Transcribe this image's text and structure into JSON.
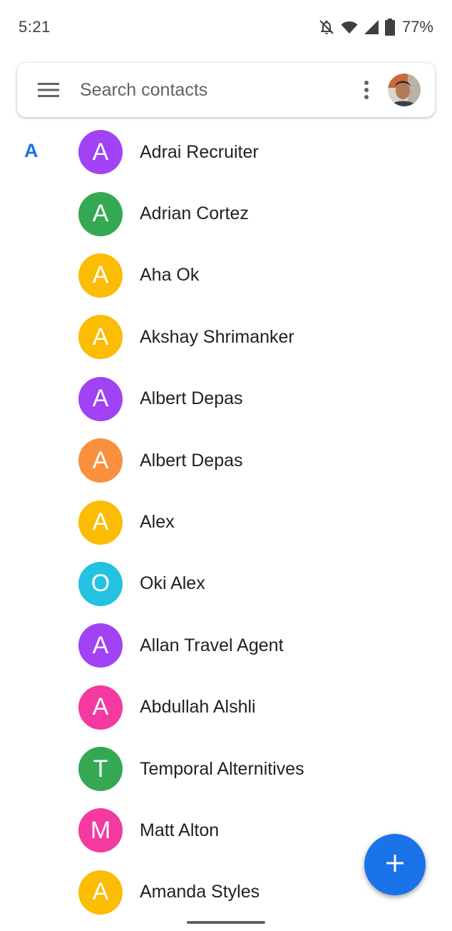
{
  "status_bar": {
    "time": "5:21",
    "battery_percent": "77%",
    "icons": [
      "notifications-off-icon",
      "wifi-icon",
      "cellular-signal-icon",
      "battery-icon"
    ]
  },
  "search": {
    "placeholder": "Search contacts",
    "menu_icon": "hamburger-menu-icon",
    "more_icon": "more-vert-icon",
    "account_icon": "account-avatar"
  },
  "contacts": {
    "section_letter": "A",
    "items": [
      {
        "initial": "A",
        "name": "Adrai Recruiter",
        "color": "#a142f4"
      },
      {
        "initial": "A",
        "name": "Adrian Cortez",
        "color": "#34a853"
      },
      {
        "initial": "A",
        "name": "Aha Ok",
        "color": "#fbbc04"
      },
      {
        "initial": "A",
        "name": "Akshay Shrimanker",
        "color": "#fbbc04"
      },
      {
        "initial": "A",
        "name": "Albert Depas",
        "color": "#a142f4"
      },
      {
        "initial": "A",
        "name": "Albert Depas",
        "color": "#fa903e"
      },
      {
        "initial": "A",
        "name": "Alex",
        "color": "#fbbc04"
      },
      {
        "initial": "O",
        "name": "Oki Alex",
        "color": "#24c1e0"
      },
      {
        "initial": "A",
        "name": "Allan Travel Agent",
        "color": "#a142f4"
      },
      {
        "initial": "A",
        "name": "Abdullah Alshli",
        "color": "#f439a0"
      },
      {
        "initial": "T",
        "name": "Temporal Alternitives",
        "color": "#34a853"
      },
      {
        "initial": "M",
        "name": "Matt Alton",
        "color": "#f439a0"
      },
      {
        "initial": "A",
        "name": "Amanda Styles",
        "color": "#fbbc04"
      }
    ]
  },
  "fab": {
    "icon": "add-icon",
    "color": "#1a73e8"
  },
  "colors": {
    "accent": "#1a73e8"
  }
}
